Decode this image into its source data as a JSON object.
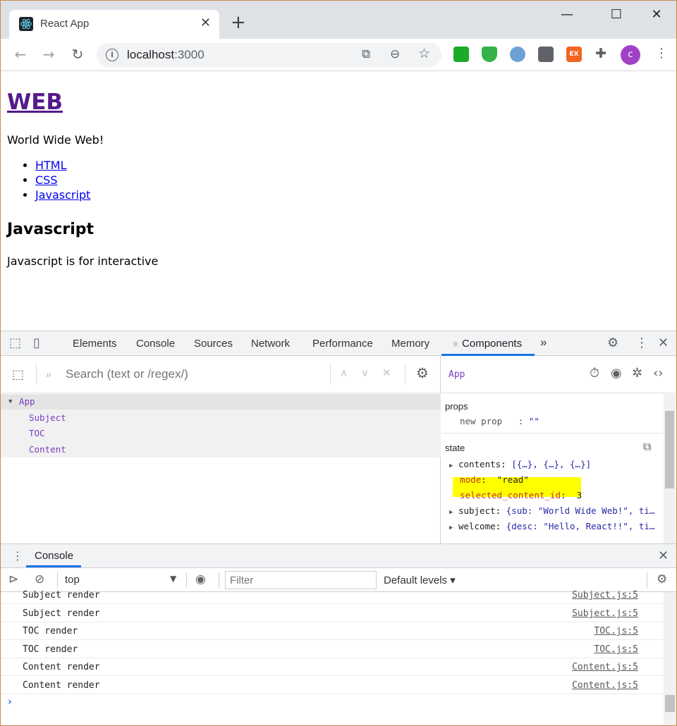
{
  "browser": {
    "tab_title": "React App",
    "new_tab": "+",
    "url_host": "localhost",
    "url_port": ":3000",
    "avatar_letter": "c",
    "window_controls": [
      "minimize-icon",
      "maximize-icon",
      "close-icon"
    ],
    "extensions": [
      "ext-green-icon",
      "ext-shield-icon",
      "ext-circle-icon",
      "ext-gray-icon",
      "ext-orange-ex-icon",
      "puzzle-icon"
    ],
    "ext_orange_label": "EX"
  },
  "page": {
    "heading": "WEB",
    "subtitle": "World Wide Web!",
    "links": [
      "HTML",
      "CSS",
      "Javascript"
    ],
    "section_title": "Javascript",
    "section_desc": "Javascript is for interactive"
  },
  "devtools": {
    "tabs": [
      "Elements",
      "Console",
      "Sources",
      "Network",
      "Performance",
      "Memory",
      "Components"
    ],
    "active_tab": "Components",
    "more": "»",
    "search_placeholder": "Search (text or /regex/)",
    "tree": [
      {
        "name": "App",
        "level": 0
      },
      {
        "name": "Subject",
        "level": 1
      },
      {
        "name": "TOC",
        "level": 1
      },
      {
        "name": "Content",
        "level": 1
      }
    ],
    "selected_component": "App",
    "props_label": "props",
    "props": [
      {
        "key": "new prop",
        "value": "\"\""
      }
    ],
    "state_label": "state",
    "state": [
      {
        "key": "contents",
        "value": "[{…}, {…}, {…}]",
        "expandable": true
      },
      {
        "key": "mode",
        "value": "\"read\"",
        "expandable": false
      },
      {
        "key": "selected_content_id",
        "value": "3",
        "expandable": false
      },
      {
        "key": "subject",
        "value": "{sub: \"World Wide Web!\", ti…",
        "expandable": true
      },
      {
        "key": "welcome",
        "value": "{desc: \"Hello, React!!\", ti…",
        "expandable": true
      }
    ]
  },
  "console": {
    "tab": "Console",
    "context": "top",
    "filter_placeholder": "Filter",
    "levels": "Default levels ▾",
    "logs": [
      {
        "msg": "Subject render",
        "src": "Subject.js:5"
      },
      {
        "msg": "Subject render",
        "src": "Subject.js:5"
      },
      {
        "msg": "TOC render",
        "src": "TOC.js:5"
      },
      {
        "msg": "TOC render",
        "src": "TOC.js:5"
      },
      {
        "msg": "Content render",
        "src": "Content.js:5"
      },
      {
        "msg": "Content render",
        "src": "Content.js:5"
      }
    ],
    "prompt": "›"
  }
}
